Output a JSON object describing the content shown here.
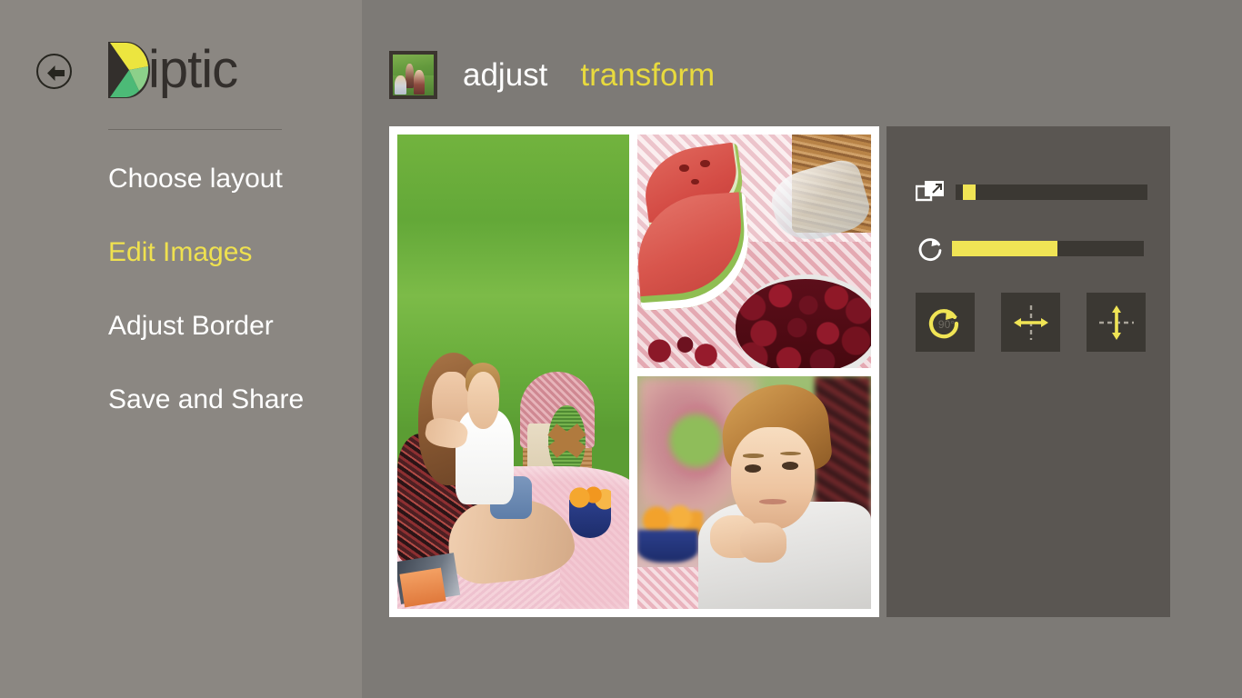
{
  "app": {
    "name": "Diptic",
    "accent_yellow": "#efe14f",
    "sidebar_bg": "#8b8782",
    "canvas_bg": "#7d7a76",
    "panel_bg": "#5a5652",
    "track_bg": "#3b3833"
  },
  "sidebar": {
    "back_button": {
      "name": "back",
      "icon": "arrow-left-icon"
    },
    "logo": {
      "text": "iptic",
      "mark": "diptic-d-logo-icon"
    },
    "items": [
      {
        "label": "Choose layout",
        "active": false
      },
      {
        "label": "Edit Images",
        "active": true
      },
      {
        "label": "Adjust Border",
        "active": false
      },
      {
        "label": "Save and Share",
        "active": false
      }
    ]
  },
  "topbar": {
    "thumbnail_alt": "selected-photo-thumbnail",
    "tabs": [
      {
        "label": "adjust",
        "active": false
      },
      {
        "label": "transform",
        "active": true
      }
    ]
  },
  "collage": {
    "layout": "1 tall left, 2 stacked right",
    "border_color": "#ffffff",
    "cells": [
      {
        "position": "left",
        "description": "mother and young boy sitting on picnic blanket on grass"
      },
      {
        "position": "right-top",
        "description": "watermelon slices, bottle and bowl of cherries on checkered cloth"
      },
      {
        "position": "right-bottom",
        "description": "young boy resting chin on hands at picnic"
      }
    ]
  },
  "panel": {
    "sliders": [
      {
        "name": "scale",
        "icon": "scale-resize-icon",
        "value": 4,
        "min": 0,
        "max": 100
      },
      {
        "name": "rotate",
        "icon": "rotate-icon",
        "value": 55,
        "min": 0,
        "max": 100
      }
    ],
    "buttons": [
      {
        "name": "rotate-90",
        "label": "90°",
        "icon": "rotate-90-icon"
      },
      {
        "name": "flip-horizontal",
        "label": "",
        "icon": "flip-horizontal-icon"
      },
      {
        "name": "flip-vertical",
        "label": "",
        "icon": "flip-vertical-icon"
      }
    ]
  }
}
